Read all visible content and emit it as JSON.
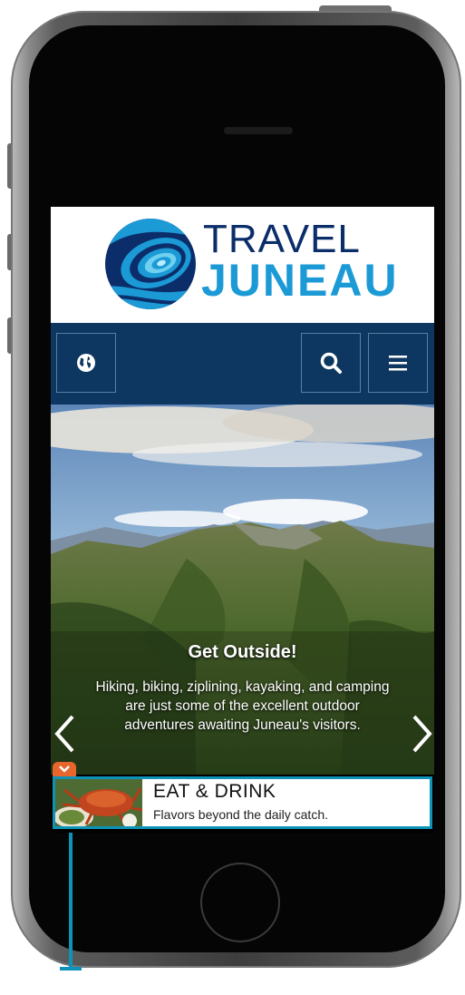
{
  "header": {
    "logo_line1": "TRAVEL",
    "logo_line2": "JUNEAU"
  },
  "nav": {
    "globe_icon": "globe-icon",
    "search_icon": "search-icon",
    "menu_icon": "hamburger-menu-icon"
  },
  "hero": {
    "title": "Get Outside!",
    "text": "Hiking, biking, ziplining, kayaking, and camping are just some of the excellent outdoor adventures awaiting Juneau's visitors."
  },
  "promo": {
    "title": "EAT & DRINK",
    "subtitle": "Flavors beyond the daily catch."
  },
  "colors": {
    "nav_bg": "#0d3760",
    "logo_dark": "#0b2e6b",
    "logo_light": "#1b9ad6",
    "accent_border": "#0e93b8",
    "close_tab": "#e8652b"
  }
}
